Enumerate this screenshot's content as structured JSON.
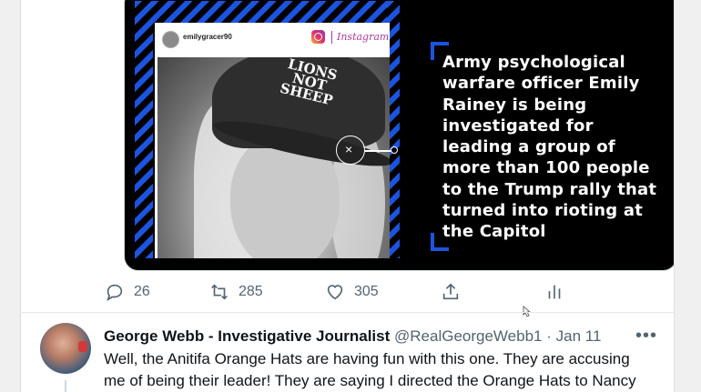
{
  "media": {
    "instagram_username": "emilygracer90",
    "instagram_brand": "Instagram",
    "cap_text": "LIONS NOT SHEEP",
    "headline": "Army psychological warfare officer Emily Rainey is being investigated for leading a group of more than 100 people to the Trump rally that turned into rioting at the Capitol",
    "zoom_symbol": "×"
  },
  "actions": {
    "reply_count": "26",
    "retweet_count": "285",
    "like_count": "305"
  },
  "tweet2": {
    "display_name": "George Webb - Investigative Journalist",
    "handle": "@RealGeorgeWebb1",
    "separator": "·",
    "date": "Jan 11",
    "more": "•••",
    "text": "Well, the Anitifa Orange Hats are having fun with this one.  They are accusing me of being their leader!  They are saying I directed the Orange Hats to Nancy"
  },
  "colors": {
    "accent_blue": "#1b54e0",
    "instagram_pink": "#b13aa0",
    "icon_gray": "#536471",
    "text_dark": "#0f1419"
  }
}
